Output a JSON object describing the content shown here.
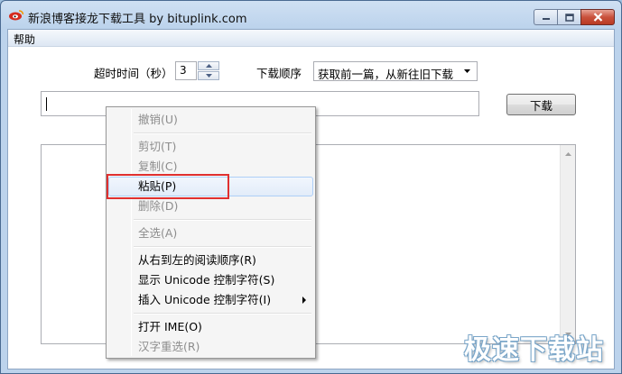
{
  "window": {
    "title": "新浪博客接龙下载工具 by bituplink.com",
    "app_icon": "sina-logo-icon",
    "caption_icons": [
      "minimize-icon",
      "maximize-icon",
      "close-icon"
    ]
  },
  "menubar": {
    "items": [
      {
        "label": "帮助"
      }
    ]
  },
  "form": {
    "timeout_label": "超时时间（秒）",
    "timeout_value": "3",
    "order_label": "下载顺序",
    "order_selected": "获取前一篇，从新往旧下载",
    "url_value": "",
    "download_label": "下载"
  },
  "context_menu": {
    "items": [
      {
        "label": "撤销(U)",
        "enabled": false
      },
      {
        "label": "剪切(T)",
        "enabled": false
      },
      {
        "label": "复制(C)",
        "enabled": false
      },
      {
        "label": "粘贴(P)",
        "enabled": true,
        "hover": true
      },
      {
        "label": "删除(D)",
        "enabled": false
      },
      {
        "label": "全选(A)",
        "enabled": false
      },
      {
        "label": "从右到左的阅读顺序(R)",
        "enabled": true
      },
      {
        "label": "显示 Unicode 控制字符(S)",
        "enabled": true
      },
      {
        "label": "插入 Unicode 控制字符(I)",
        "enabled": true,
        "submenu": true
      },
      {
        "label": "打开 IME(O)",
        "enabled": true
      },
      {
        "label": "汉字重选(R)",
        "enabled": false
      }
    ]
  },
  "colors": {
    "highlight_border": "#e0302f",
    "titlebar": "#bcd3ec",
    "close_button": "#c9513c"
  },
  "watermark": "极速下载站"
}
